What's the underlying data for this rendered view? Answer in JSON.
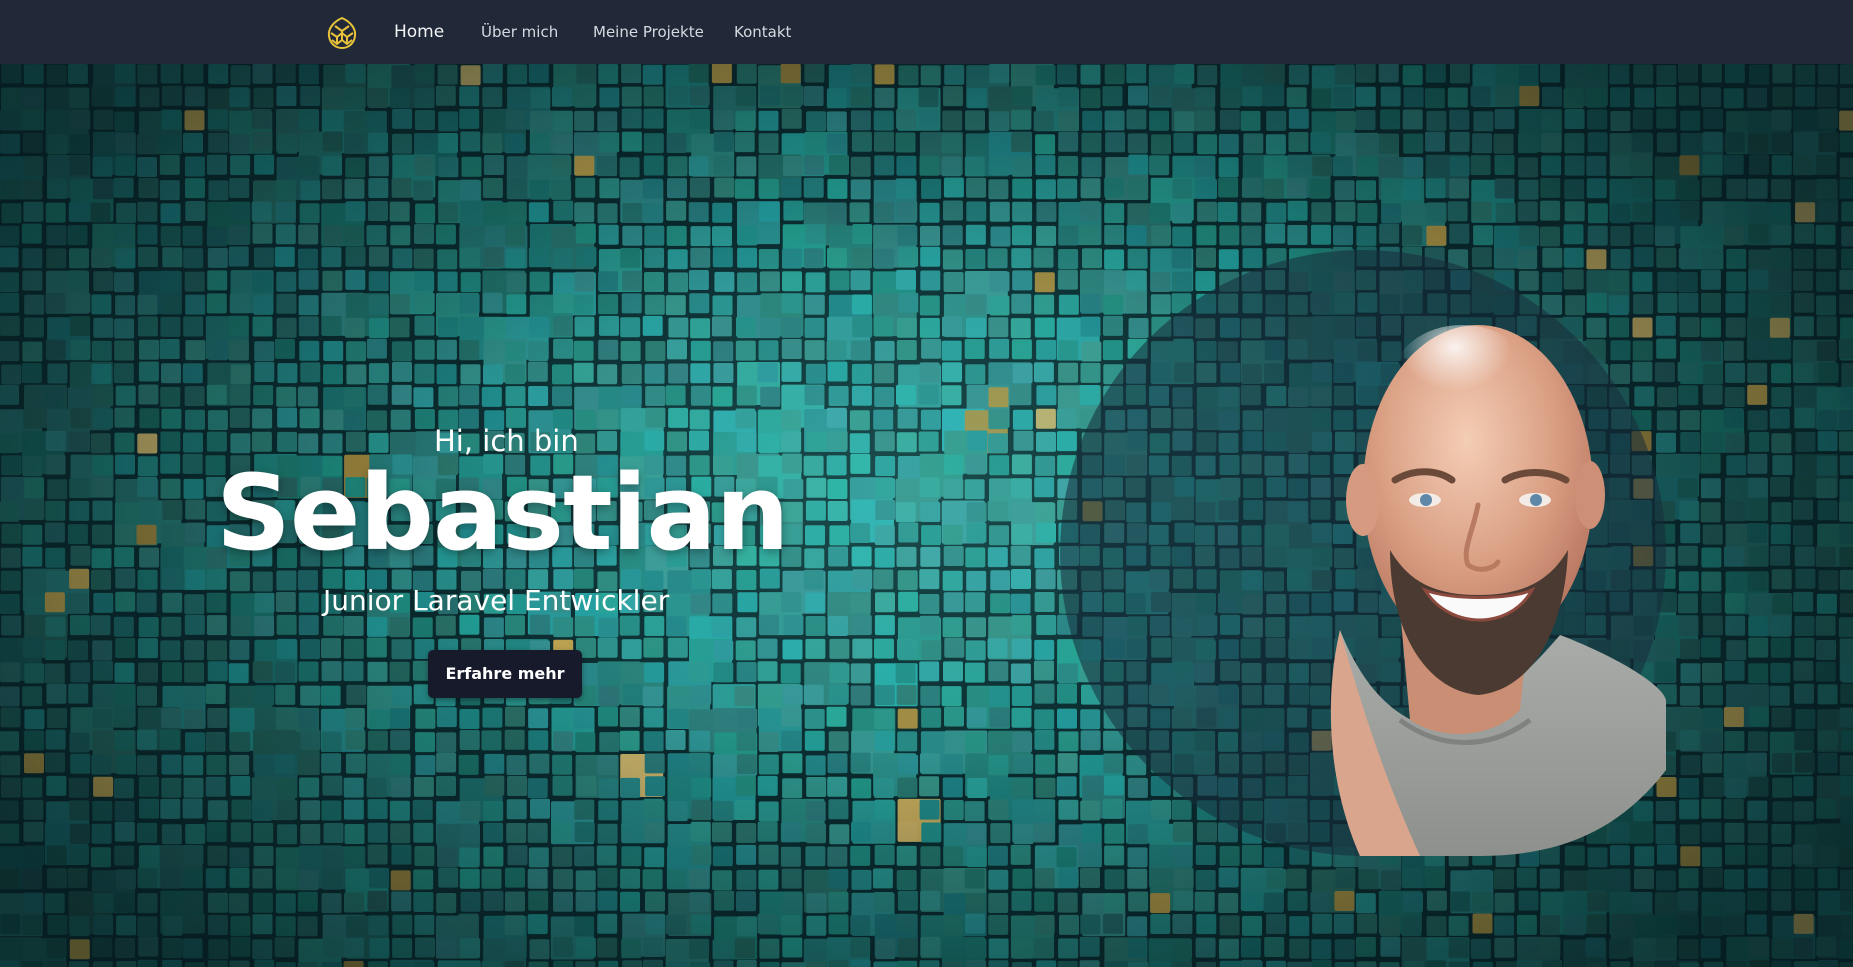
{
  "nav": {
    "logo_icon": "pinecone-icon",
    "links": [
      {
        "label": "Home",
        "active": true
      },
      {
        "label": "Über mich",
        "active": false
      },
      {
        "label": "Meine Projekte",
        "active": false
      },
      {
        "label": "Kontakt",
        "active": false
      }
    ]
  },
  "hero": {
    "greeting": "Hi, ich bin",
    "name": "Sebastian",
    "subtitle": "Junior Laravel Entwickler",
    "cta_label": "Erfahre mehr",
    "background": "teal-mosaic-tiles",
    "portrait": "person-photo"
  },
  "colors": {
    "nav_bg": "#212838",
    "logo": "#e8c33a",
    "hero_teal": "#1f7f7a",
    "cta_bg": "#171a2b",
    "text": "#ffffff"
  }
}
